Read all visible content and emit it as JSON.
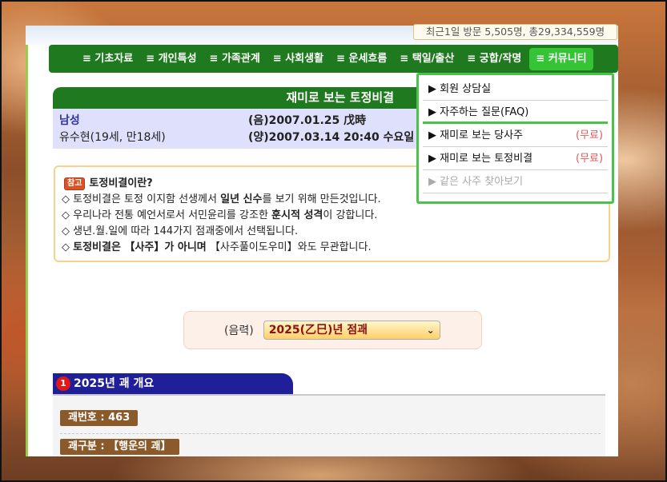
{
  "visitor_stats": "최근1일 방문 5,505명, 총29,334,559명",
  "nav": [
    {
      "label": "≡ 기초자료"
    },
    {
      "label": "≡ 개인특성"
    },
    {
      "label": "≡ 가족관계"
    },
    {
      "label": "≡ 사회생활"
    },
    {
      "label": "≡ 운세흐름"
    },
    {
      "label": "≡ 택일/출산"
    },
    {
      "label": "≡ 궁합/작명"
    },
    {
      "label": "≡ 커뮤니티"
    }
  ],
  "dropdown": {
    "items": [
      {
        "label": "▶ 회원 상담실",
        "note": ""
      },
      {
        "label": "▶ 자주하는 질문(FAQ)",
        "note": ""
      },
      {
        "label": "▶ 재미로 보는 당사주",
        "note": "(무료)"
      },
      {
        "label": "▶ 재미로 보는 토정비결",
        "note": "(무료)"
      },
      {
        "label": "▶ 같은 사주 찾아보기",
        "note": ""
      }
    ]
  },
  "title": "재미로 보는 토정비결",
  "person": {
    "gender": "남성",
    "name": "유수현(19세, 만18세)",
    "lunar": "(음)2007.01.25 戊時",
    "solar": "(양)2007.03.14 20:40 수요일"
  },
  "info": {
    "badge": "참고",
    "heading": "토정비결이란?",
    "line1_a": "◇ 토정비결은 토정 이지함 선생께서 ",
    "line1_b": "일년 신수",
    "line1_c": "를 보기 위해 만든것입니다.",
    "line2_a": "◇ 우리나라 전통 예언서로서 서민윤리를 강조한 ",
    "line2_b": "훈시적 성격",
    "line2_c": "이 강합니다.",
    "line3": "◇ 생년.월.일에 따라 144가지 점괘중에서 선택됩니다.",
    "line4_a": "◇ ",
    "line4_b": "토정비결은 【사주】가 아니며",
    "line4_c": " 【사주풀이도우미】와도 무관합니다."
  },
  "year_select": {
    "label": "(음력)",
    "value": "2025(乙巳)년 점괘"
  },
  "section": {
    "number": "1",
    "title": "2025년 괘 개요",
    "tag1": "괘번호 : 463",
    "tag2": "괘구분 : 【행운의 괘】"
  }
}
